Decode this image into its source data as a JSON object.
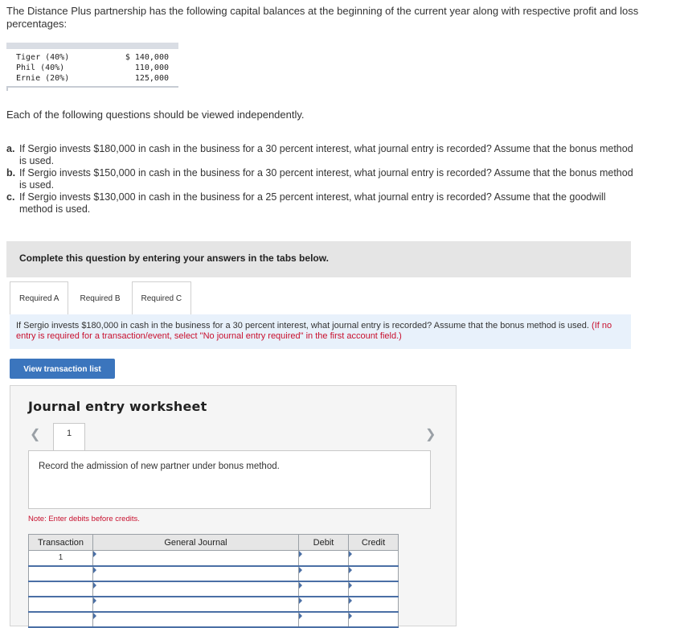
{
  "intro": "The Distance Plus partnership has the following capital balances at the beginning of the current year along with respective profit and loss percentages:",
  "capital": [
    {
      "name": "Tiger (40%)",
      "amount": "$ 140,000"
    },
    {
      "name": "Phil (40%)",
      "amount": "110,000"
    },
    {
      "name": "Ernie (20%)",
      "amount": "125,000"
    }
  ],
  "independent": "Each of the following questions should be viewed independently.",
  "questions": [
    {
      "letter": "a.",
      "text": "If Sergio invests $180,000 in cash in the business for a 30 percent interest, what journal entry is recorded? Assume that the bonus method is used."
    },
    {
      "letter": "b.",
      "text": "If Sergio invests $150,000 in cash in the business for a 30 percent interest, what journal entry is recorded? Assume that the bonus method is used."
    },
    {
      "letter": "c.",
      "text": "If Sergio invests $130,000 in cash in the business for a 25 percent interest, what journal entry is recorded? Assume that the goodwill method is used."
    }
  ],
  "banner": "Complete this question by entering your answers in the tabs below.",
  "tabs": [
    "Required A",
    "Required B",
    "Required C"
  ],
  "prompt": {
    "text": "If Sergio invests $180,000 in cash in the business for a 30 percent interest, what journal entry is recorded? Assume that the bonus method is used.",
    "hint": "(If no entry is required for a transaction/event, select \"No journal entry required\" in the first account field.)"
  },
  "view_button": "View transaction list",
  "worksheet": {
    "title": "Journal entry worksheet",
    "page": "1",
    "description": "Record the admission of new partner under bonus method.",
    "note": "Note: Enter debits before credits.",
    "headers": [
      "Transaction",
      "General Journal",
      "Debit",
      "Credit"
    ],
    "rows": [
      {
        "transaction": "1"
      },
      {
        "transaction": ""
      },
      {
        "transaction": ""
      },
      {
        "transaction": ""
      },
      {
        "transaction": ""
      }
    ]
  }
}
